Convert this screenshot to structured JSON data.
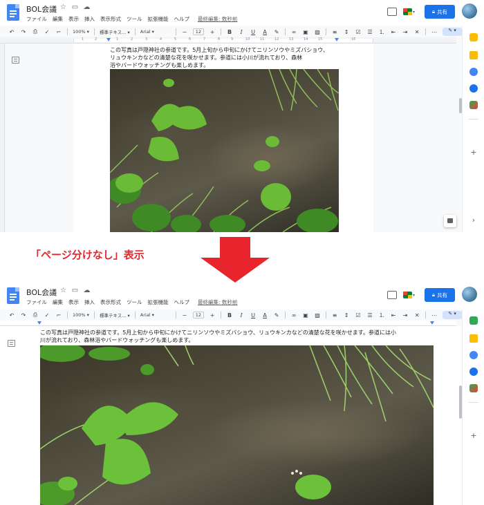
{
  "top": {
    "doc_title": "BOL会議",
    "menus": [
      "ファイル",
      "編集",
      "表示",
      "挿入",
      "表示形式",
      "ツール",
      "拡張機能",
      "ヘルプ"
    ],
    "last_edit": "最終編集: 数秒前",
    "share_label": "共有",
    "toolbar": {
      "zoom": "100%",
      "style": "標準テキス...",
      "font": "Arial",
      "font_size": "12"
    },
    "ruler_numbers": [
      "1",
      "2",
      "1",
      "2",
      "3",
      "4",
      "5",
      "6",
      "7",
      "8",
      "9",
      "10",
      "11",
      "12",
      "13",
      "14",
      "15",
      "16",
      "17",
      "18"
    ],
    "body_lines": [
      "この写真は戸隠神社の参道です。5月上旬から中旬にかけてニリンソウやミズバショウ、",
      "リュウキンカなどの清楚な花を咲かせます。参道には小川が流れており、森林",
      "浴やバードウォッチングも楽しめます。"
    ]
  },
  "caption": "「ページ分けなし」表示",
  "bottom": {
    "doc_title": "BOL会議",
    "menus": [
      "ファイル",
      "編集",
      "表示",
      "挿入",
      "表示形式",
      "ツール",
      "拡張機能",
      "ヘルプ"
    ],
    "last_edit": "最終編集: 数秒前",
    "share_label": "共有",
    "toolbar": {
      "zoom": "100%",
      "style": "標準テキス...",
      "font": "Arial",
      "font_size": "12"
    },
    "body_lines": [
      "この写真は戸隠神社の参道です。5月上旬から中旬にかけてニリンソウやミズバショウ、リュウキンカなどの清楚な花を咲かせます。参道には小",
      "川が流れており、森林浴やバードウォッチングも楽しめます。"
    ]
  },
  "colors": {
    "accent": "#1a73e8",
    "caption_red": "#e8242c",
    "arrow_red": "#e8242c"
  },
  "icons": [
    "docs-logo",
    "star-icon",
    "folder-icon",
    "cloud-icon",
    "comment-icon",
    "meet-icon",
    "lock-icon",
    "undo-icon",
    "redo-icon",
    "print-icon",
    "spellcheck-icon",
    "paint-format-icon",
    "bold-icon",
    "italic-icon",
    "underline-icon",
    "text-color-icon",
    "highlight-icon",
    "link-icon",
    "insert-comment-icon",
    "image-icon",
    "align-icon",
    "line-spacing-icon",
    "checklist-icon",
    "bullet-list-icon",
    "numbered-list-icon",
    "indent-icon",
    "outdent-icon",
    "more-icon",
    "edit-mode-icon",
    "chevron-up-icon"
  ]
}
